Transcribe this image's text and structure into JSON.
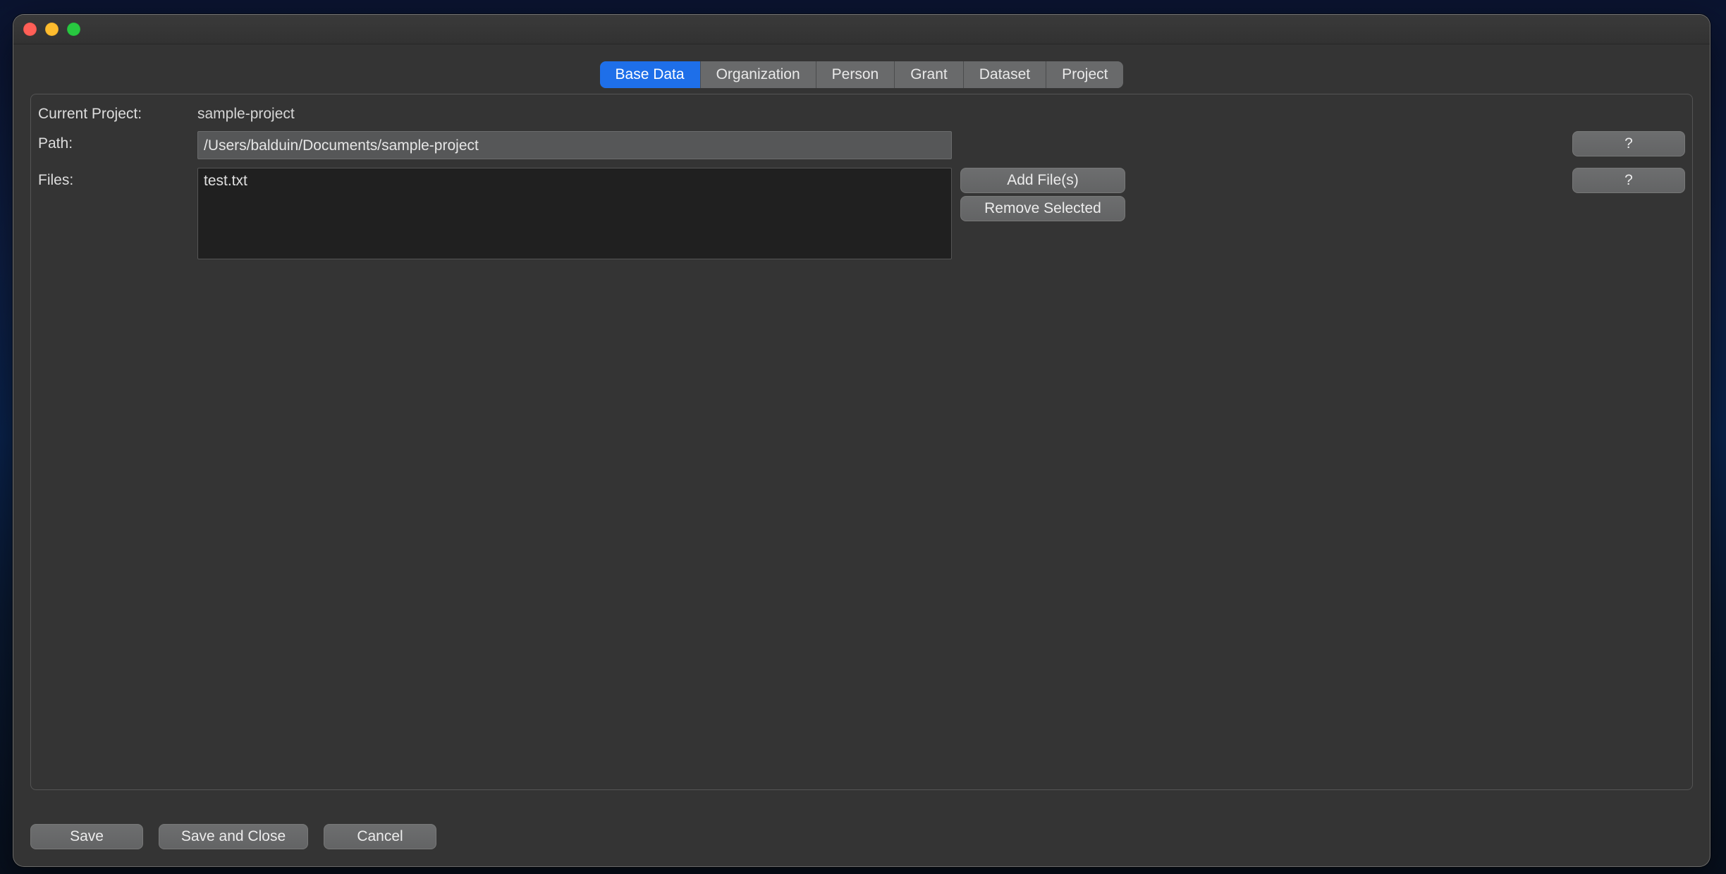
{
  "tabs": {
    "base_data": "Base Data",
    "organization": "Organization",
    "person": "Person",
    "grant": "Grant",
    "dataset": "Dataset",
    "project": "Project",
    "active": "base_data"
  },
  "form": {
    "current_project_label": "Current Project:",
    "current_project_value": "sample-project",
    "path_label": "Path:",
    "path_value": "/Users/balduin/Documents/sample-project",
    "files_label": "Files:",
    "files": [
      "test.txt"
    ],
    "add_files_label": "Add File(s)",
    "remove_selected_label": "Remove Selected",
    "help_label": "?"
  },
  "footer": {
    "save": "Save",
    "save_and_close": "Save and Close",
    "cancel": "Cancel"
  }
}
